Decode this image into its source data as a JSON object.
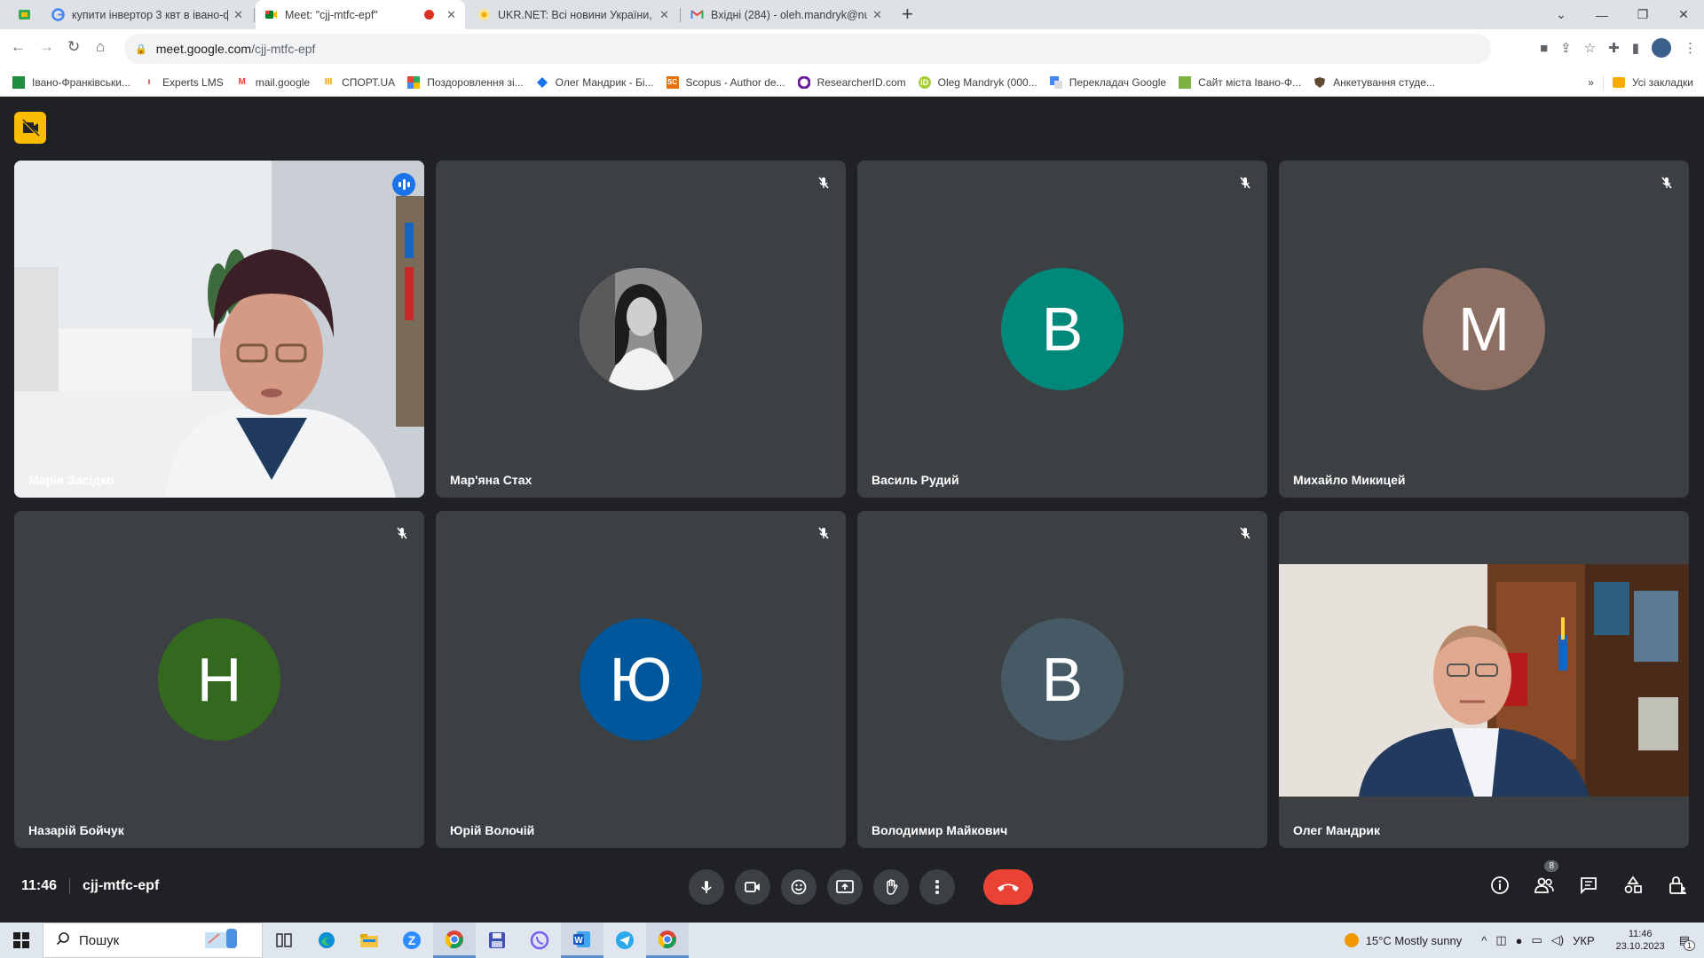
{
  "browser": {
    "tabs": [
      {
        "title": "купити інвертор 3 квт в івано-ф",
        "icon": "google-icon"
      },
      {
        "title": "Meet: \"cjj-mtfc-epf\"",
        "icon": "meet-icon",
        "active": true,
        "recording": true
      },
      {
        "title": "UKR.NET: Всі новини України, о",
        "icon": "ukrnet-icon"
      },
      {
        "title": "Вхідні (284) - oleh.mandryk@nu",
        "icon": "gmail-icon"
      }
    ],
    "url_host": "meet.google.com",
    "url_path": "/cjj-mtfc-epf",
    "bookmarks": [
      "Івано-Франківськи...",
      "Experts LMS",
      "mail.google",
      "СПОРТ.UA",
      "Поздоровлення зі...",
      "Олег Мандрик - Бі...",
      "Scopus - Author de...",
      "ResearcherID.com",
      "Oleg Mandryk (000...",
      "Перекладач Google",
      "Сайт міста Івано-Ф...",
      "Анкетування студе..."
    ],
    "bookmarks_more": "»",
    "all_bookmarks": "Усі закладки"
  },
  "meet": {
    "participants": [
      {
        "name": "Марія Засідко",
        "type": "video",
        "speaking": true
      },
      {
        "name": "Мар'яна Стах",
        "type": "photo",
        "muted": true
      },
      {
        "name": "Василь Рудий",
        "type": "letter",
        "letter": "В",
        "color": "#00897b",
        "muted": true
      },
      {
        "name": "Михайло Микицей",
        "type": "letter",
        "letter": "М",
        "color": "#8d6e63",
        "muted": true
      },
      {
        "name": "Назарій Бойчук",
        "type": "letter",
        "letter": "Н",
        "color": "#33691e",
        "muted": true
      },
      {
        "name": "Юрій Волочій",
        "type": "letter",
        "letter": "Ю",
        "color": "#01579b",
        "muted": true
      },
      {
        "name": "Володимир Майкович",
        "type": "letter",
        "letter": "В",
        "color": "#455a64",
        "muted": true
      },
      {
        "name": "Олег Мандрик",
        "type": "video2"
      }
    ],
    "time": "11:46",
    "meeting_code": "cjj-mtfc-epf",
    "people_count": "8"
  },
  "taskbar": {
    "search_placeholder": "Пошук",
    "weather": "15°C  Mostly sunny",
    "lang": "УКР",
    "time": "11:46",
    "date": "23.10.2023",
    "notifications": "1"
  }
}
